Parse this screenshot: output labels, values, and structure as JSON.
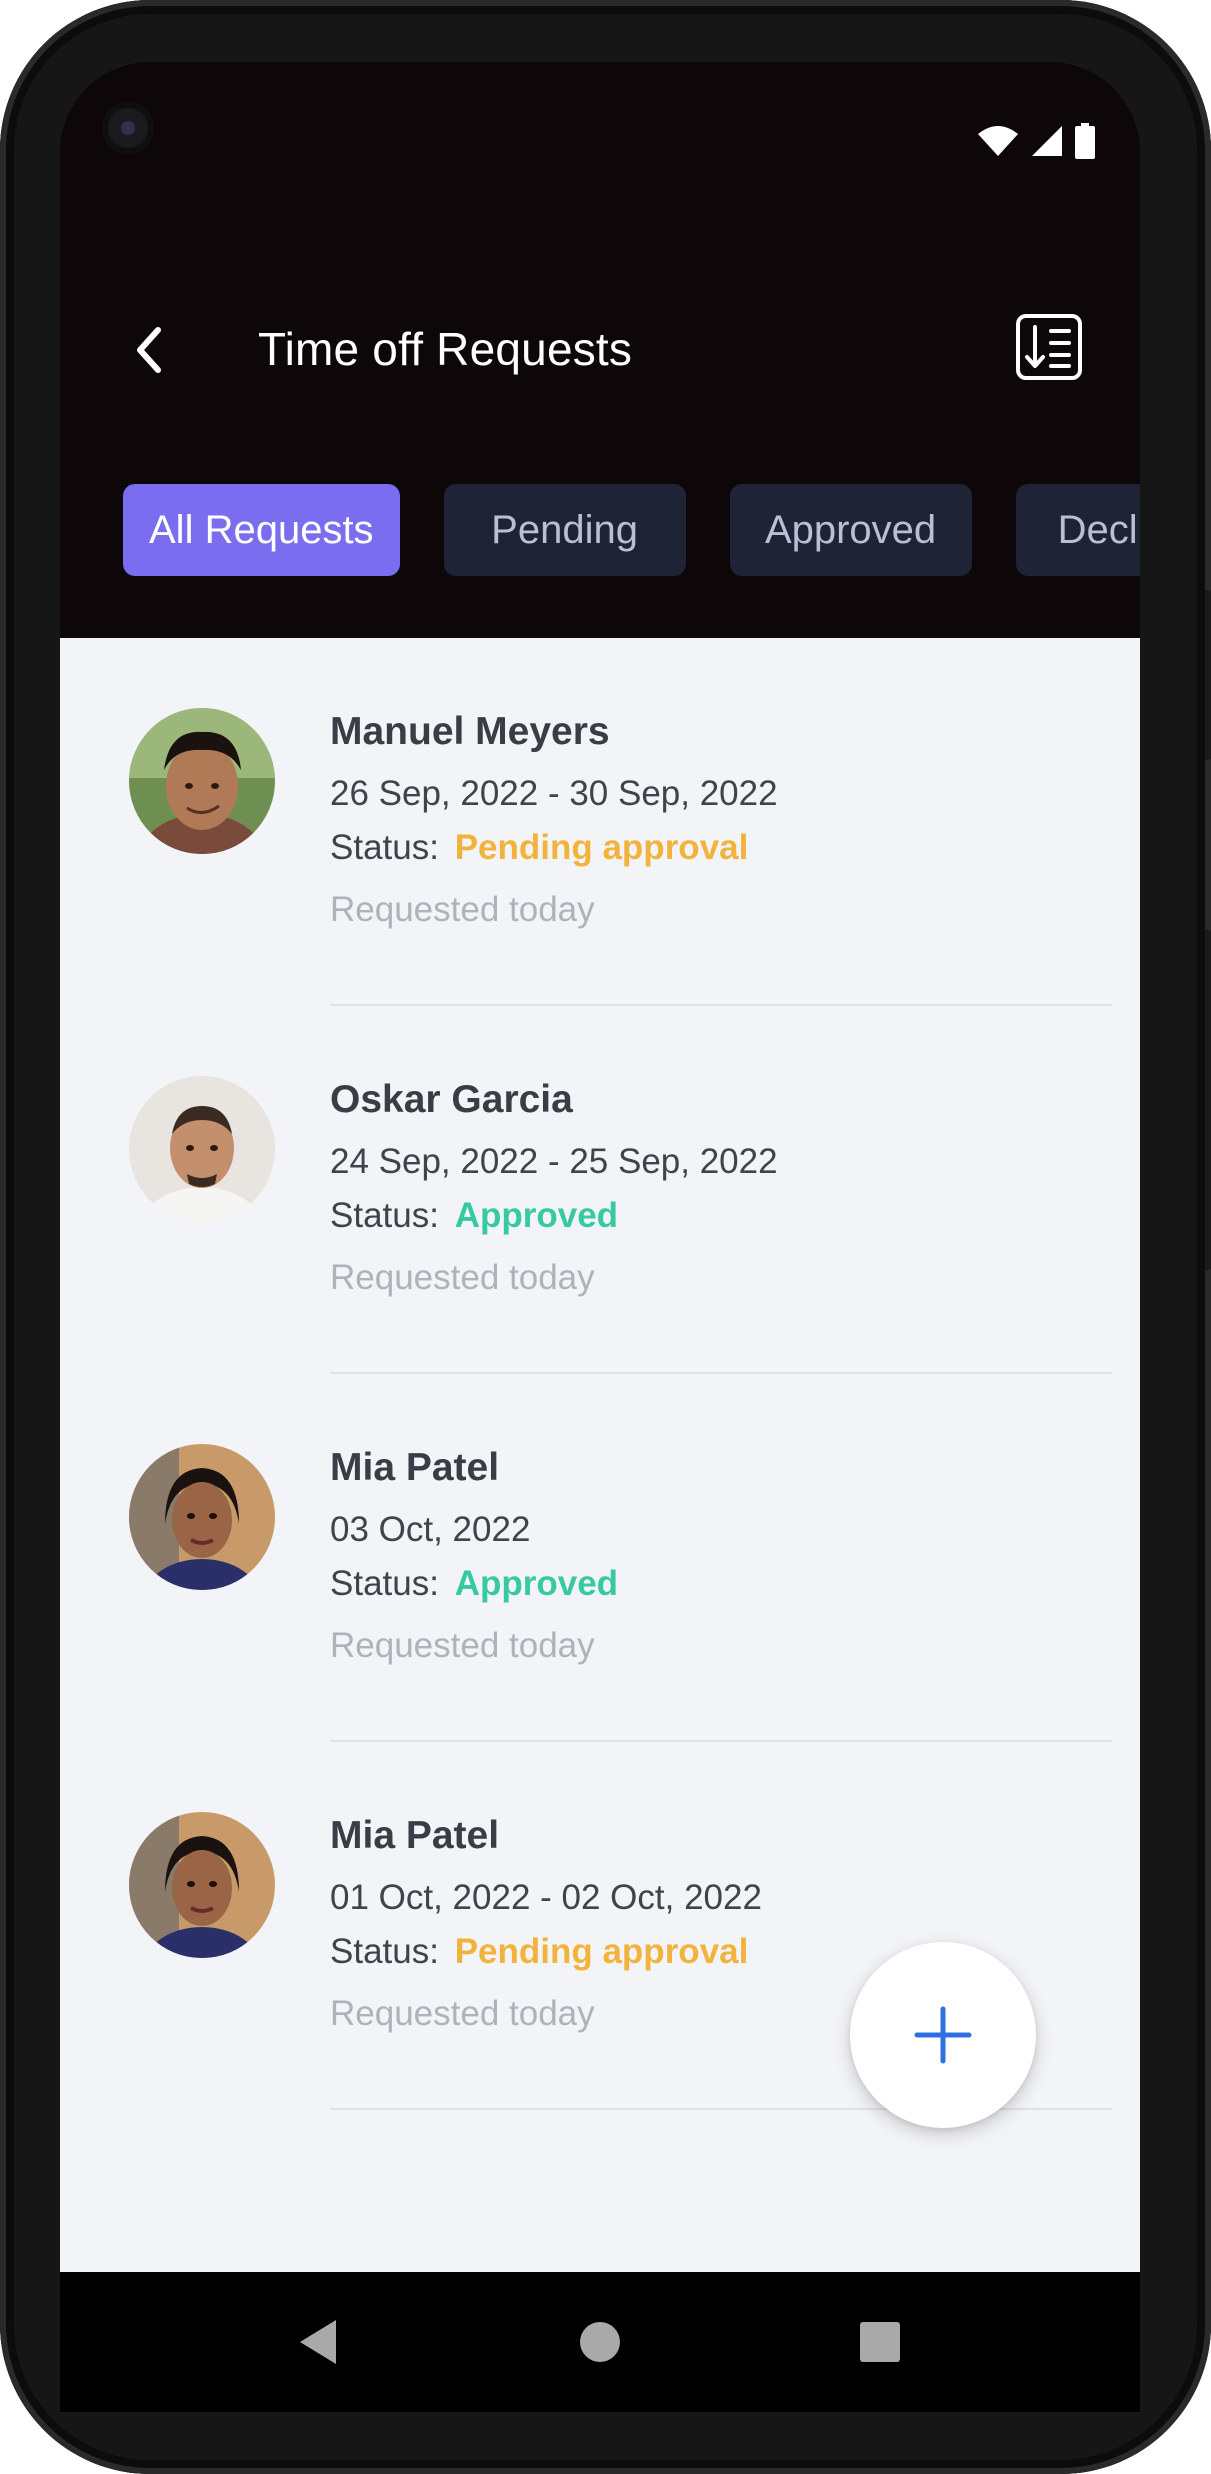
{
  "header": {
    "title": "Time off Requests"
  },
  "tabs": [
    {
      "label": "All Requests",
      "active": true
    },
    {
      "label": "Pending",
      "active": false
    },
    {
      "label": "Approved",
      "active": false
    },
    {
      "label": "Declined",
      "active": false
    }
  ],
  "requests": [
    {
      "name": "Manuel Meyers",
      "dates": "26 Sep, 2022 - 30 Sep, 2022",
      "status_label": "Status:",
      "status_value": "Pending approval",
      "status_type": "pending",
      "requested": "Requested today"
    },
    {
      "name": "Oskar Garcia",
      "dates": "24 Sep, 2022 - 25 Sep, 2022",
      "status_label": "Status:",
      "status_value": "Approved",
      "status_type": "approved",
      "requested": "Requested today"
    },
    {
      "name": "Mia Patel",
      "dates": "03 Oct, 2022",
      "status_label": "Status:",
      "status_value": "Approved",
      "status_type": "approved",
      "requested": "Requested today"
    },
    {
      "name": "Mia Patel",
      "dates": "01 Oct, 2022 - 02 Oct, 2022",
      "status_label": "Status:",
      "status_value": "Pending approval",
      "status_type": "pending",
      "requested": "Requested today"
    }
  ],
  "colors": {
    "accent": "#7a6df0",
    "pending": "#f2b33d",
    "approved": "#36c9a2",
    "fab_icon": "#2f6fe0"
  },
  "icons": {
    "back": "chevron-left-icon",
    "sort": "sort-list-icon",
    "fab": "plus-icon",
    "wifi": "wifi-icon",
    "signal": "signal-icon",
    "battery": "battery-icon"
  }
}
